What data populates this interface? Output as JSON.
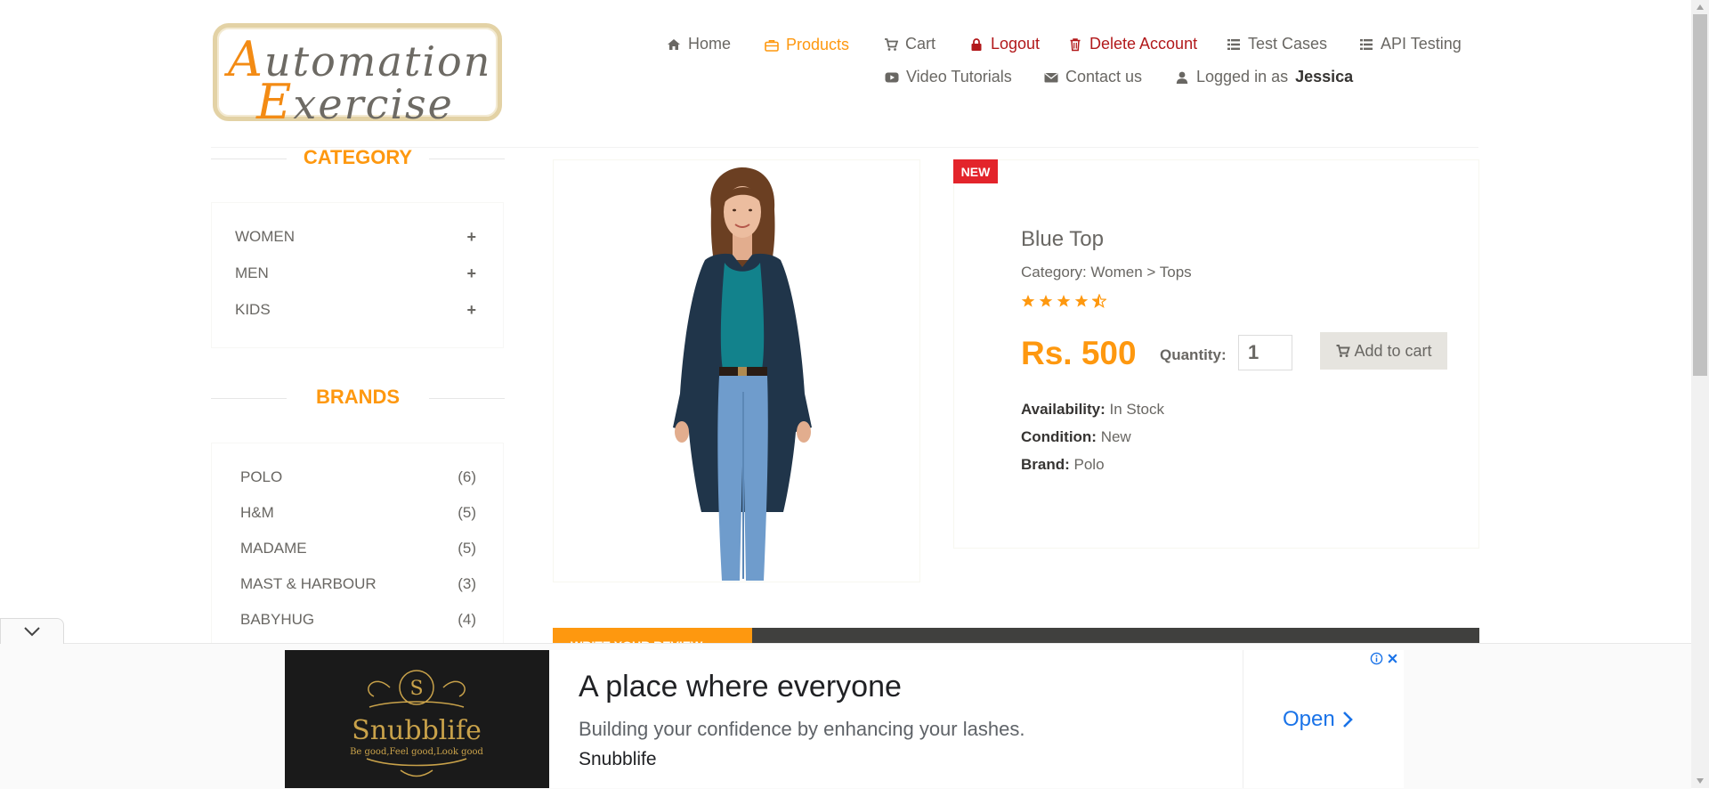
{
  "logo": {
    "line1_cap": "A",
    "line1_rest": "utomation",
    "line2_cap": "E",
    "line2_rest": "xercise"
  },
  "nav": {
    "home": "Home",
    "products": "Products",
    "cart": "Cart",
    "logout": "Logout",
    "delete_account": "Delete Account",
    "test_cases": "Test Cases",
    "api_testing": "API Testing",
    "video_tutorials": "Video Tutorials",
    "contact_us": "Contact us",
    "logged_in_prefix": "Logged in as",
    "username": "Jessica"
  },
  "sidebar": {
    "category_title": "CATEGORY",
    "categories": [
      {
        "label": "WOMEN"
      },
      {
        "label": "MEN"
      },
      {
        "label": "KIDS"
      }
    ],
    "brands_title": "BRANDS",
    "brands": [
      {
        "label": "POLO",
        "count": "(6)"
      },
      {
        "label": "H&M",
        "count": "(5)"
      },
      {
        "label": "MADAME",
        "count": "(5)"
      },
      {
        "label": "MAST & HARBOUR",
        "count": "(3)"
      },
      {
        "label": "BABYHUG",
        "count": "(4)"
      }
    ]
  },
  "product": {
    "badge": "NEW",
    "title": "Blue Top",
    "category": "Category: Women > Tops",
    "rating": 4.5,
    "price": "Rs. 500",
    "quantity_label": "Quantity:",
    "quantity_value": "1",
    "add_to_cart": "Add to cart",
    "availability_label": "Availability:",
    "availability": "In Stock",
    "condition_label": "Condition:",
    "condition": "New",
    "brand_label": "Brand:",
    "brand": "Polo"
  },
  "review": {
    "tab": "WRITE YOUR REVIEW"
  },
  "ad": {
    "headline": "A place where everyone",
    "subline": "Building your confidence by enhancing your lashes.",
    "brand": "Snubblife",
    "open": "Open",
    "logo_letter": "S",
    "logo_name": "Snubblife",
    "logo_tagline": "Be good,Feel good,Look good"
  },
  "colors": {
    "accent": "#FE980F",
    "danger": "#b2191b",
    "badge": "#e3242b",
    "text": "#696763"
  }
}
